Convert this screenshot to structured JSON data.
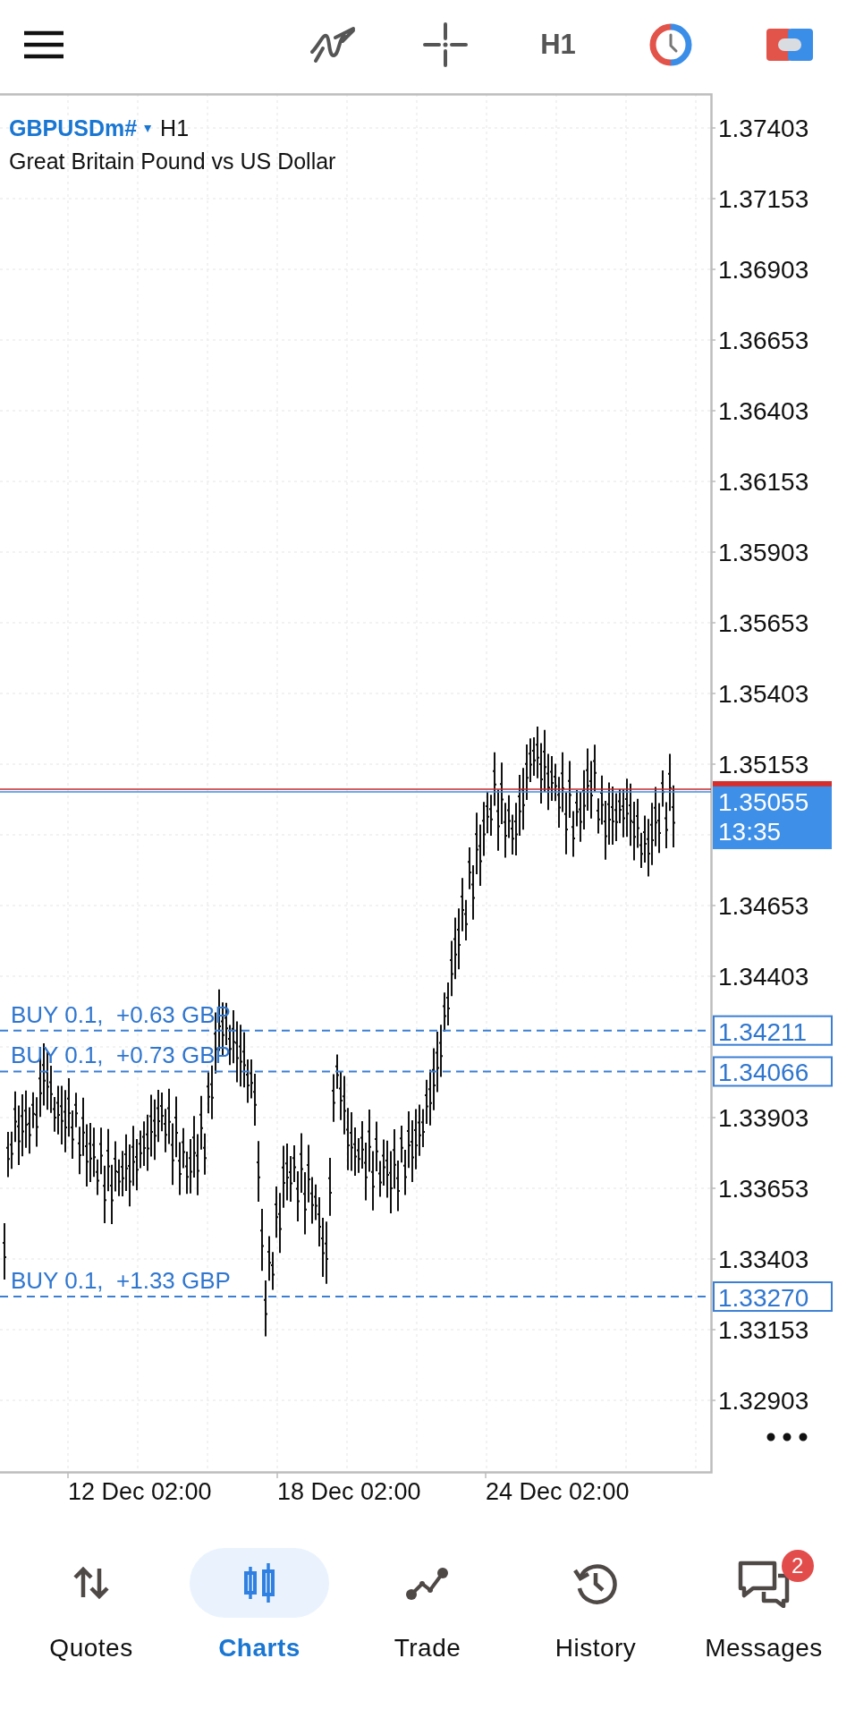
{
  "toolbar": {
    "timeframe": "H1"
  },
  "chart": {
    "symbol": "GBPUSDm#",
    "timeframe": "H1",
    "description": "Great Britain Pound vs US Dollar",
    "price_labels": [
      "1.37403",
      "1.37153",
      "1.36903",
      "1.36653",
      "1.36403",
      "1.36153",
      "1.35903",
      "1.35653",
      "1.35403",
      "1.35153",
      "1.34653",
      "1.34403",
      "1.33903",
      "1.33653",
      "1.33403",
      "1.33153",
      "1.32903"
    ],
    "current_price": "1.35055",
    "bar_timer": "13:35",
    "orders": [
      {
        "label": "BUY 0.1,  +0.63 GBP",
        "price": "1.34211"
      },
      {
        "label": "BUY 0.1,  +0.73 GBP",
        "price": "1.34066"
      },
      {
        "label": "BUY 0.1,  +1.33 GBP",
        "price": "1.33270"
      }
    ],
    "time_labels": [
      "12 Dec 02:00",
      "18 Dec 02:00",
      "24 Dec 02:00"
    ]
  },
  "nav": [
    {
      "kind": "quotes",
      "label": "Quotes",
      "selected": false
    },
    {
      "kind": "charts",
      "label": "Charts",
      "selected": true
    },
    {
      "kind": "trade",
      "label": "Trade",
      "selected": false
    },
    {
      "kind": "history",
      "label": "History",
      "selected": false
    },
    {
      "kind": "messages",
      "label": "Messages",
      "selected": false,
      "badge": "2"
    }
  ]
}
